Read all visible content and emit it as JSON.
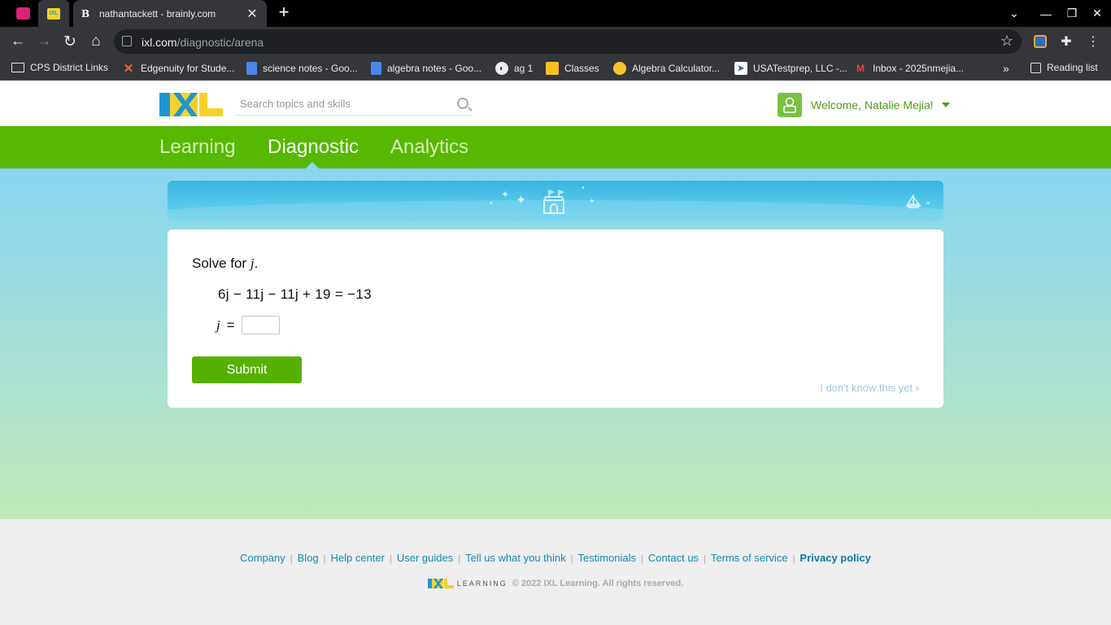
{
  "browser": {
    "tab_title": "nathantackett - brainly.com",
    "url_host": "ixl.com",
    "url_path": "/diagnostic/arena",
    "bookmarks": [
      {
        "label": "CPS District Links"
      },
      {
        "label": "Edgenuity for Stude..."
      },
      {
        "label": "science notes - Goo..."
      },
      {
        "label": "algebra notes - Goo..."
      },
      {
        "label": "ag 1"
      },
      {
        "label": "Classes"
      },
      {
        "label": "Algebra Calculator..."
      },
      {
        "label": "USATestprep, LLC -..."
      },
      {
        "label": "Inbox - 2025nmejia..."
      }
    ],
    "reading_list": "Reading list"
  },
  "header": {
    "logo_text": "IXL",
    "search_placeholder": "Search topics and skills",
    "welcome": "Welcome, Natalie Mejia!"
  },
  "nav": {
    "items": [
      {
        "label": "Learning"
      },
      {
        "label": "Diagnostic"
      },
      {
        "label": "Analytics"
      }
    ]
  },
  "question": {
    "prompt_prefix": "Solve for",
    "prompt_var": "j",
    "prompt_suffix": ".",
    "equation": "6j − 11j − 11j + 19 = −13",
    "answer_var": "j",
    "answer_eq": "=",
    "answer_value": "",
    "submit": "Submit",
    "dont_know": "I don't know this yet ›"
  },
  "footer": {
    "links": [
      {
        "label": "Company"
      },
      {
        "label": "Blog"
      },
      {
        "label": "Help center"
      },
      {
        "label": "User guides"
      },
      {
        "label": "Tell us what you think"
      },
      {
        "label": "Testimonials"
      },
      {
        "label": "Contact us"
      },
      {
        "label": "Terms of service"
      },
      {
        "label": "Privacy policy"
      }
    ],
    "learning": "LEARNING",
    "copyright": "© 2022 IXL Learning. All rights reserved."
  },
  "colors": {
    "nav_green": "#56b800",
    "submit_green": "#56b000",
    "link_blue": "#168ab2",
    "brand_yellow": "#f3d32b",
    "brand_blue": "#1f96d3"
  }
}
